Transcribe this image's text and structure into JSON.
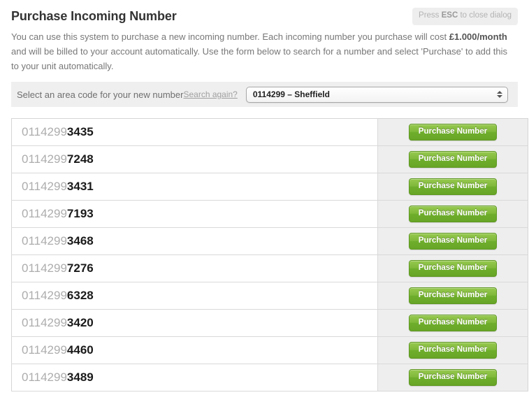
{
  "header": {
    "title": "Purchase Incoming Number",
    "esc_badge_prefix": "Press ",
    "esc_badge_key": "ESC",
    "esc_badge_suffix": " to close dialog"
  },
  "description": {
    "part1": "You can use this system to purchase a new incoming number. Each incoming number you purchase will cost ",
    "price": "£1.000/month",
    "part2": " and will be billed to your account automatically. Use the form below to search for a number and select 'Purchase' to add this to your unit automatically."
  },
  "form": {
    "label": "Select an area code for your new number",
    "search_again_link": "Search again?",
    "select_value": "0114299 – Sheffield",
    "stepper_icon": "up-down-stepper-icon"
  },
  "results": {
    "prefix": "0114299",
    "button_label": "Purchase Number",
    "rows": [
      {
        "prefix": "0114299",
        "suffix": "3435",
        "button_label": "Purchase Number"
      },
      {
        "prefix": "0114299",
        "suffix": "7248",
        "button_label": "Purchase Number"
      },
      {
        "prefix": "0114299",
        "suffix": "3431",
        "button_label": "Purchase Number"
      },
      {
        "prefix": "0114299",
        "suffix": "7193",
        "button_label": "Purchase Number"
      },
      {
        "prefix": "0114299",
        "suffix": "3468",
        "button_label": "Purchase Number"
      },
      {
        "prefix": "0114299",
        "suffix": "7276",
        "button_label": "Purchase Number"
      },
      {
        "prefix": "0114299",
        "suffix": "6328",
        "button_label": "Purchase Number"
      },
      {
        "prefix": "0114299",
        "suffix": "3420",
        "button_label": "Purchase Number"
      },
      {
        "prefix": "0114299",
        "suffix": "4460",
        "button_label": "Purchase Number"
      },
      {
        "prefix": "0114299",
        "suffix": "3489",
        "button_label": "Purchase Number"
      }
    ]
  },
  "colors": {
    "accent_green": "#7fb83a",
    "green_border": "#5f9822",
    "title": "#333333",
    "body_text": "#777777",
    "row_alt_bg": "#eeeeee",
    "form_bg": "#efefef",
    "border": "#d9d9d9"
  }
}
